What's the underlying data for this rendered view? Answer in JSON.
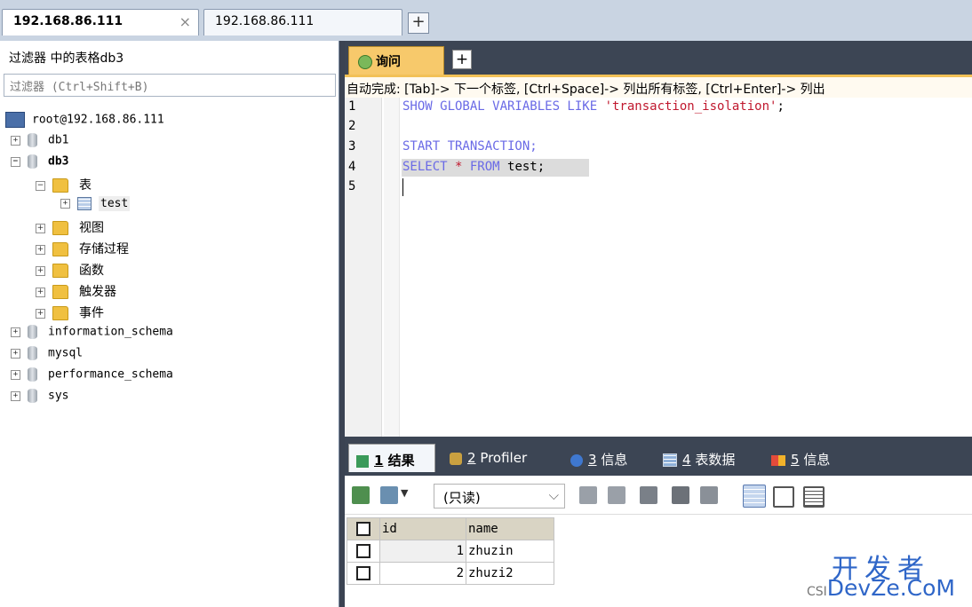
{
  "connections": {
    "tabs": [
      {
        "label": "192.168.86.111",
        "active": true,
        "close": "×"
      },
      {
        "label": "192.168.86.111",
        "active": false
      }
    ],
    "add": "+"
  },
  "filter": {
    "title": "过滤器 中的表格db3",
    "placeholder": "过滤器 (Ctrl+Shift+B)"
  },
  "tree": {
    "root": "root@192.168.86.111",
    "items": [
      {
        "label": "db1",
        "expander": "+"
      },
      {
        "label": "db3",
        "expander": "−"
      },
      {
        "label": "表",
        "expander": "−"
      },
      {
        "label": "test",
        "expander": "+"
      },
      {
        "label": "视图",
        "expander": "+"
      },
      {
        "label": "存储过程",
        "expander": "+"
      },
      {
        "label": "函数",
        "expander": "+"
      },
      {
        "label": "触发器",
        "expander": "+"
      },
      {
        "label": "事件",
        "expander": "+"
      },
      {
        "label": "information_schema",
        "expander": "+"
      },
      {
        "label": "mysql",
        "expander": "+"
      },
      {
        "label": "performance_schema",
        "expander": "+"
      },
      {
        "label": "sys",
        "expander": "+"
      }
    ]
  },
  "query_tab": {
    "label": "询问",
    "add": "+"
  },
  "hint": "自动完成: [Tab]-> 下一个标签, [Ctrl+Space]-> 列出所有标签, [Ctrl+Enter]-> 列出",
  "editor": {
    "line_numbers": [
      "1",
      "2",
      "3",
      "4",
      "5"
    ],
    "line1": {
      "kw": "SHOW GLOBAL VARIABLES LIKE ",
      "str": "'transaction_isolation'",
      "end": ";"
    },
    "line3": {
      "kw": "START TRANSACTION;"
    },
    "line4": {
      "kw1": "SELECT",
      "op": " * ",
      "kw2": "FROM",
      "rest": " test;"
    }
  },
  "result_tabs": [
    {
      "num": "1",
      "label": " 结果"
    },
    {
      "num": "2",
      "label": " Profiler"
    },
    {
      "num": "3",
      "label": " 信息"
    },
    {
      "num": "4",
      "label": " 表数据"
    },
    {
      "num": "5",
      "label": " 信息"
    }
  ],
  "result_toolbar": {
    "mode": "(只读)",
    "mode_arrow": "⌵"
  },
  "grid": {
    "columns": [
      "id",
      "name"
    ],
    "rows": [
      {
        "id": "1",
        "name": "zhuzin"
      },
      {
        "id": "2",
        "name": "zhuzi2"
      }
    ]
  },
  "watermark": {
    "top": "开发者",
    "prefix": "CSI",
    "bottom": "DevZe.CoM"
  },
  "colors": {
    "accent": "#f7c96b",
    "keyword": "#6a6ae6",
    "string": "#c0182e",
    "dark_bar": "#3c4554"
  }
}
